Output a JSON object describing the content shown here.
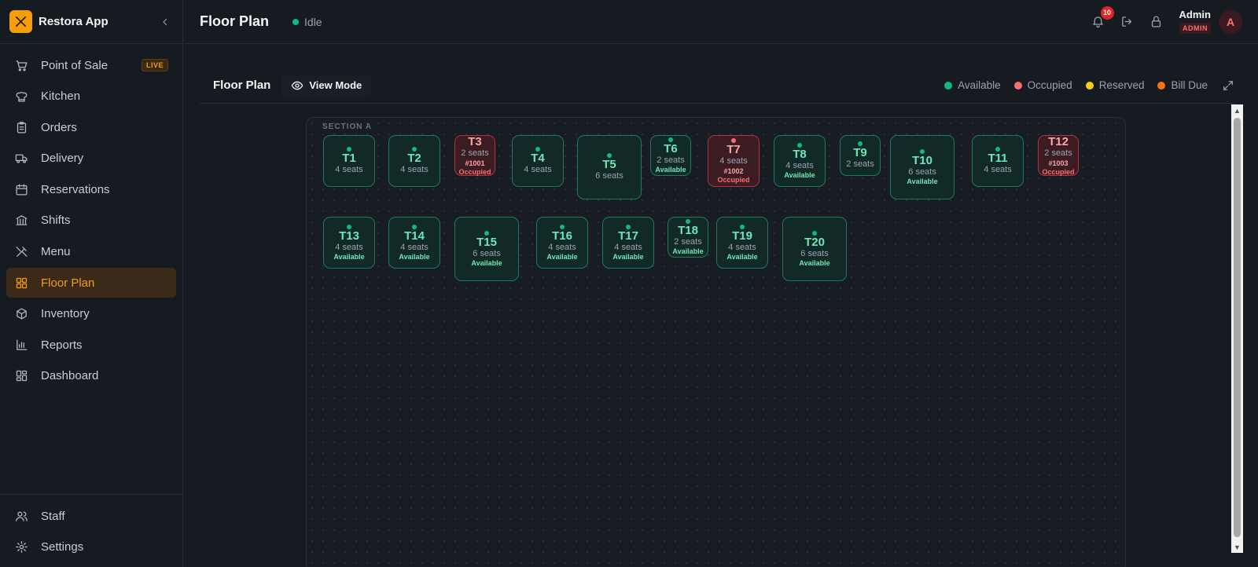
{
  "app": {
    "name": "Restora App"
  },
  "sidebar": {
    "items": [
      {
        "label": "Point of Sale",
        "icon": "cart-icon",
        "badge": "LIVE"
      },
      {
        "label": "Kitchen",
        "icon": "chef-hat-icon"
      },
      {
        "label": "Orders",
        "icon": "clipboard-icon"
      },
      {
        "label": "Delivery",
        "icon": "truck-icon"
      },
      {
        "label": "Reservations",
        "icon": "calendar-icon"
      },
      {
        "label": "Shifts",
        "icon": "bank-icon"
      },
      {
        "label": "Menu",
        "icon": "utensils-icon"
      },
      {
        "label": "Floor Plan",
        "icon": "grid-icon",
        "active": true
      },
      {
        "label": "Inventory",
        "icon": "package-icon"
      },
      {
        "label": "Reports",
        "icon": "bar-chart-icon"
      },
      {
        "label": "Dashboard",
        "icon": "dashboard-icon"
      }
    ],
    "bottom_items": [
      {
        "label": "Staff",
        "icon": "users-icon"
      },
      {
        "label": "Settings",
        "icon": "gear-icon"
      }
    ]
  },
  "header": {
    "title": "Floor Plan",
    "status": "Idle",
    "notifications_count": "10",
    "user": {
      "name": "Admin",
      "role": "ADMIN",
      "initial": "A"
    }
  },
  "toolbar": {
    "title": "Floor Plan",
    "view_mode_label": "View Mode",
    "legend": [
      {
        "label": "Available",
        "color": "#10b981"
      },
      {
        "label": "Occupied",
        "color": "#f87171"
      },
      {
        "label": "Reserved",
        "color": "#facc15"
      },
      {
        "label": "Bill Due",
        "color": "#f97316"
      }
    ]
  },
  "floor": {
    "section_label": "SECTION A",
    "tables": [
      {
        "name": "T1",
        "seats": "4 seats",
        "state": "available"
      },
      {
        "name": "T2",
        "seats": "4 seats",
        "state": "available"
      },
      {
        "name": "T3",
        "seats": "2 seats",
        "state": "occupied",
        "order": "#1001",
        "status": "Occupied"
      },
      {
        "name": "T4",
        "seats": "4 seats",
        "state": "available"
      },
      {
        "name": "T5",
        "seats": "6 seats",
        "state": "available"
      },
      {
        "name": "T6",
        "seats": "2 seats",
        "state": "available",
        "status": "Available"
      },
      {
        "name": "T7",
        "seats": "4 seats",
        "state": "occupied",
        "order": "#1002",
        "status": "Occupied"
      },
      {
        "name": "T8",
        "seats": "4 seats",
        "state": "available",
        "status": "Available"
      },
      {
        "name": "T9",
        "seats": "2 seats",
        "state": "available"
      },
      {
        "name": "T10",
        "seats": "6 seats",
        "state": "available",
        "status": "Available"
      },
      {
        "name": "T11",
        "seats": "4 seats",
        "state": "available"
      },
      {
        "name": "T12",
        "seats": "2 seats",
        "state": "occupied",
        "order": "#1003",
        "status": "Occupied"
      },
      {
        "name": "T13",
        "seats": "4 seats",
        "state": "available",
        "status": "Available"
      },
      {
        "name": "T14",
        "seats": "4 seats",
        "state": "available",
        "status": "Available"
      },
      {
        "name": "T15",
        "seats": "6 seats",
        "state": "available",
        "status": "Available"
      },
      {
        "name": "T16",
        "seats": "4 seats",
        "state": "available",
        "status": "Available"
      },
      {
        "name": "T17",
        "seats": "4 seats",
        "state": "available",
        "status": "Available"
      },
      {
        "name": "T18",
        "seats": "2 seats",
        "state": "available",
        "status": "Available"
      },
      {
        "name": "T19",
        "seats": "4 seats",
        "state": "available",
        "status": "Available"
      },
      {
        "name": "T20",
        "seats": "6 seats",
        "state": "available",
        "status": "Available"
      }
    ]
  }
}
